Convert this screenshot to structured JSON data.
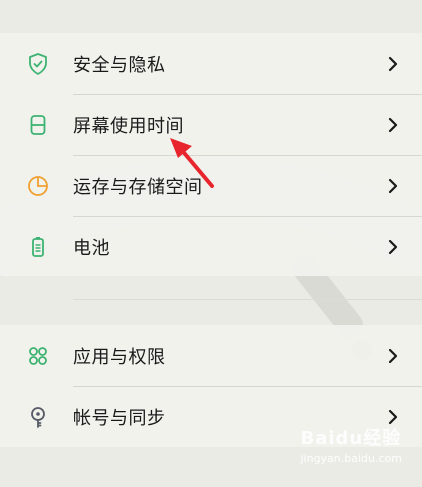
{
  "colors": {
    "background": "#ebebe6",
    "green_icon": "#3cb371",
    "orange_icon": "#f0a030",
    "gray_icon": "#555a66",
    "arrow": "#e8252c",
    "chevron": "#1a1a1a"
  },
  "section1": {
    "items": [
      {
        "label": "安全与隐私",
        "icon": "shield-check-icon"
      },
      {
        "label": "屏幕使用时间",
        "icon": "hourglass-icon"
      },
      {
        "label": "运存与存储空间",
        "icon": "pie-chart-icon"
      },
      {
        "label": "电池",
        "icon": "battery-icon"
      }
    ]
  },
  "section2": {
    "items": [
      {
        "label": "应用与权限",
        "icon": "app-grid-icon"
      },
      {
        "label": "帐号与同步",
        "icon": "key-icon"
      }
    ]
  },
  "watermark": {
    "brand": "Baidu经验",
    "sub": "jingyan.baidu.com"
  }
}
